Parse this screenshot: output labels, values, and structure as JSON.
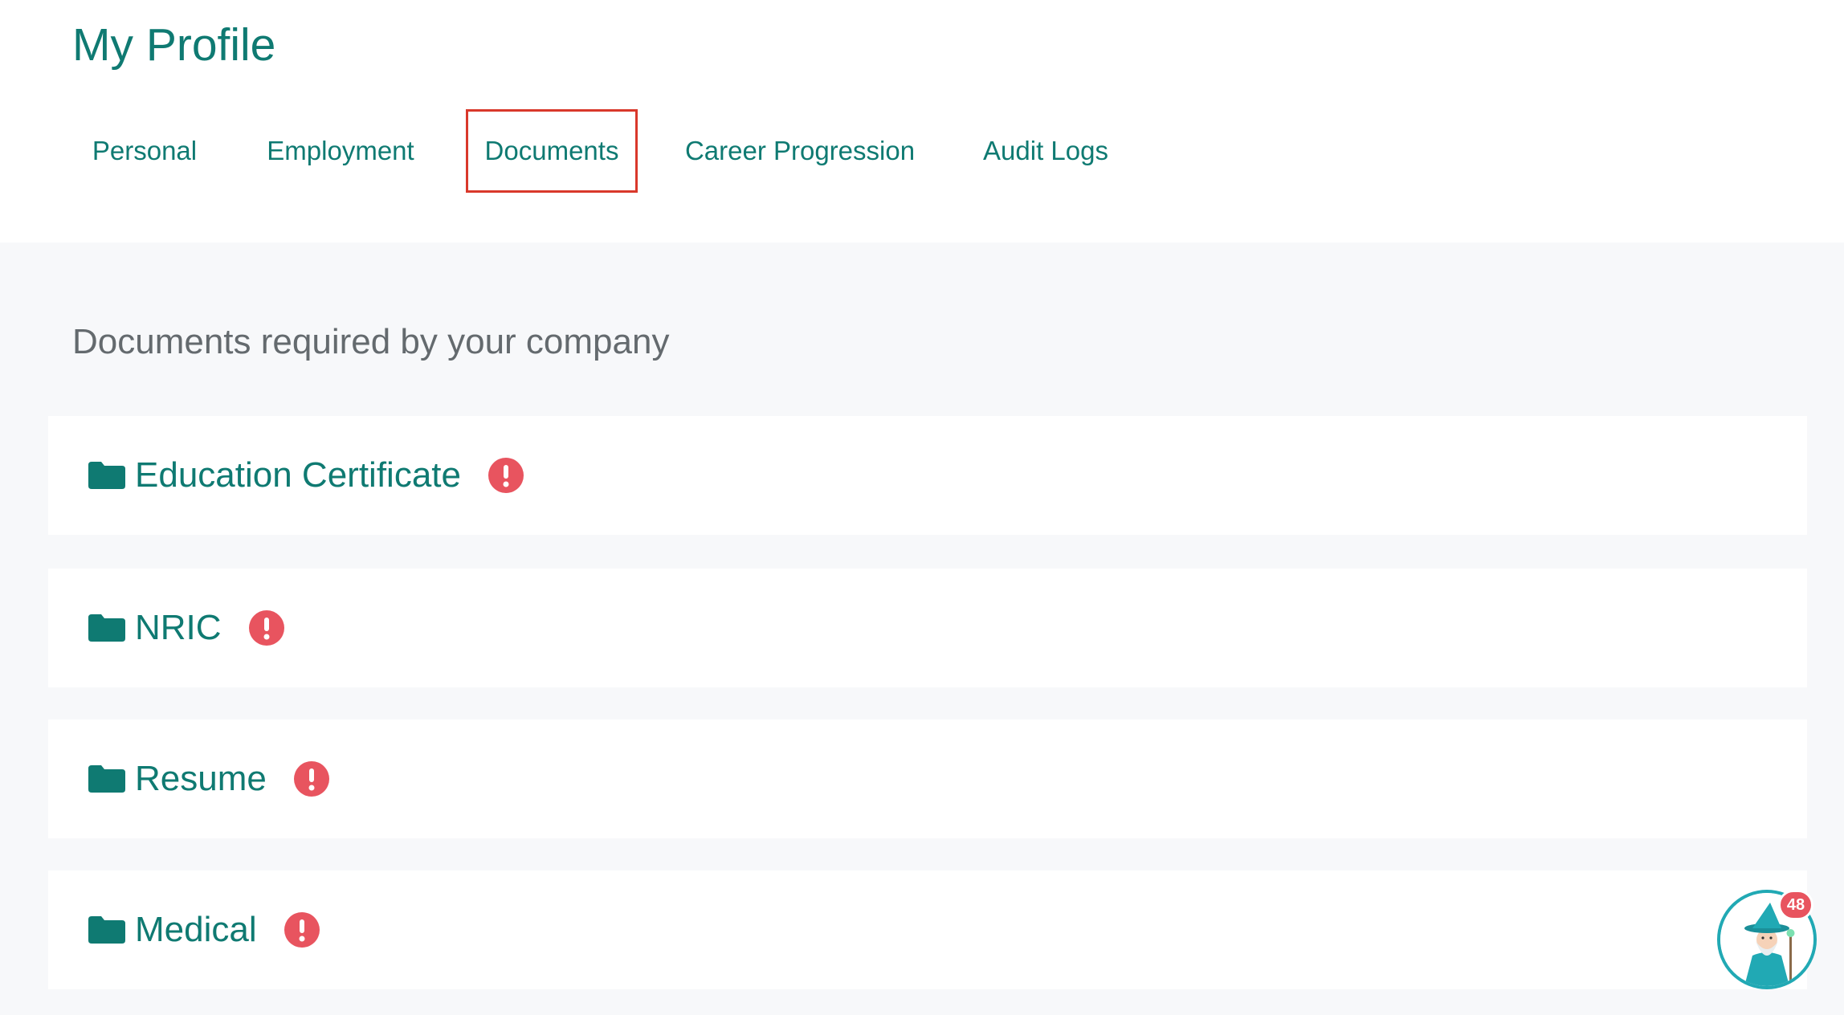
{
  "page": {
    "title": "My Profile"
  },
  "tabs": [
    {
      "label": "Personal"
    },
    {
      "label": "Employment"
    },
    {
      "label": "Documents",
      "active": true
    },
    {
      "label": "Career Progression"
    },
    {
      "label": "Audit Logs"
    }
  ],
  "documents": {
    "heading": "Documents required by your company",
    "items": [
      {
        "title": "Education Certificate",
        "icon": "folder-icon",
        "status_icon": "alert-icon"
      },
      {
        "title": "NRIC",
        "icon": "folder-icon",
        "status_icon": "alert-icon"
      },
      {
        "title": "Resume",
        "icon": "folder-icon",
        "status_icon": "alert-icon"
      },
      {
        "title": "Medical",
        "icon": "folder-icon",
        "status_icon": "alert-icon"
      }
    ]
  },
  "assistant": {
    "icon": "wizard-avatar-icon",
    "badge_count": "48"
  },
  "colors": {
    "accent": "#0f7a72",
    "alert": "#e8545f",
    "active_tab_border": "#d9382b",
    "content_background": "#f7f8fa"
  }
}
